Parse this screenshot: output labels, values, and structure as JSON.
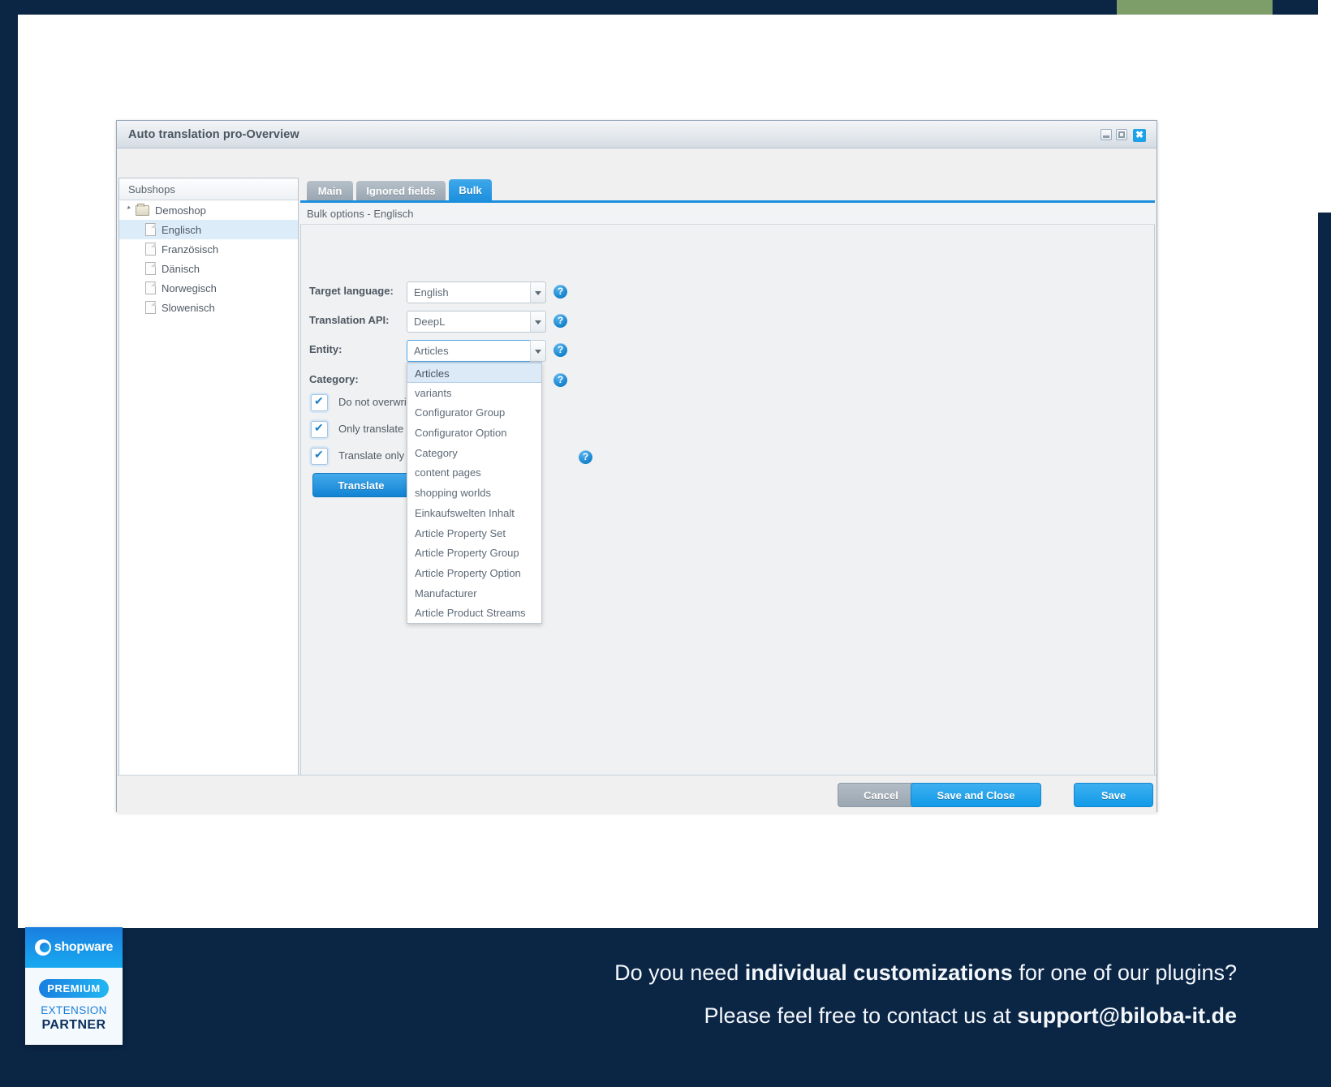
{
  "frame": {
    "accent_dark": "#0b2545",
    "accent_green": "#7e9e69"
  },
  "window": {
    "title": "Auto translation pro-Overview",
    "minimize_label": "",
    "maximize_label": "",
    "close_label": "✖"
  },
  "sidebar": {
    "header": "Subshops",
    "root": {
      "label": "Demoshop",
      "icon": "folder-icon",
      "expanded": true
    },
    "items": [
      {
        "label": "Englisch",
        "icon": "document-icon",
        "selected": true
      },
      {
        "label": "Französisch",
        "icon": "document-icon",
        "selected": false
      },
      {
        "label": "Dänisch",
        "icon": "document-icon",
        "selected": false
      },
      {
        "label": "Norwegisch",
        "icon": "document-icon",
        "selected": false
      },
      {
        "label": "Slowenisch",
        "icon": "document-icon",
        "selected": false
      }
    ]
  },
  "tabs": [
    {
      "label": "Main",
      "active": false
    },
    {
      "label": "Ignored fields",
      "active": false
    },
    {
      "label": "Bulk",
      "active": true
    }
  ],
  "subheader": "Bulk options - Englisch",
  "form": {
    "target_language": {
      "label": "Target language:",
      "value": "English",
      "help": "?"
    },
    "translation_api": {
      "label": "Translation API:",
      "value": "DeepL",
      "help": "?"
    },
    "entity": {
      "label": "Entity:",
      "value": "Articles",
      "help": "?",
      "expanded": true
    },
    "category": {
      "label": "Category:",
      "value": "",
      "help": "?"
    },
    "entity_options": [
      "Articles",
      "variants",
      "Configurator Group",
      "Configurator Option",
      "Category",
      "content pages",
      "shopping worlds",
      "Einkaufswelten Inhalt",
      "Article Property Set",
      "Article Property Group",
      "Article Property Option",
      "Manufacturer",
      "Article Product Streams"
    ],
    "entity_selected_option": "Articles",
    "checkboxes": [
      {
        "label": "Do not overwrite",
        "checked": true
      },
      {
        "label": "Only translate",
        "checked": true
      },
      {
        "label": "Translate only main article, not variants",
        "checked": true,
        "help": "?"
      }
    ],
    "translate_button": "Translate"
  },
  "footer": {
    "cancel": "Cancel",
    "save_and_close": "Save and Close",
    "save": "Save"
  },
  "banner": {
    "line1_pre": "Do you need ",
    "line1_bold": "individual customizations",
    "line1_post": " for one of our plugins?",
    "line2_pre": "Please feel free to contact us at ",
    "line2_bold": "support@biloba-it.de",
    "badge": {
      "wordmark": "shopware",
      "premium": "PREMIUM",
      "extension": "EXTENSION",
      "partner": "PARTNER"
    }
  }
}
